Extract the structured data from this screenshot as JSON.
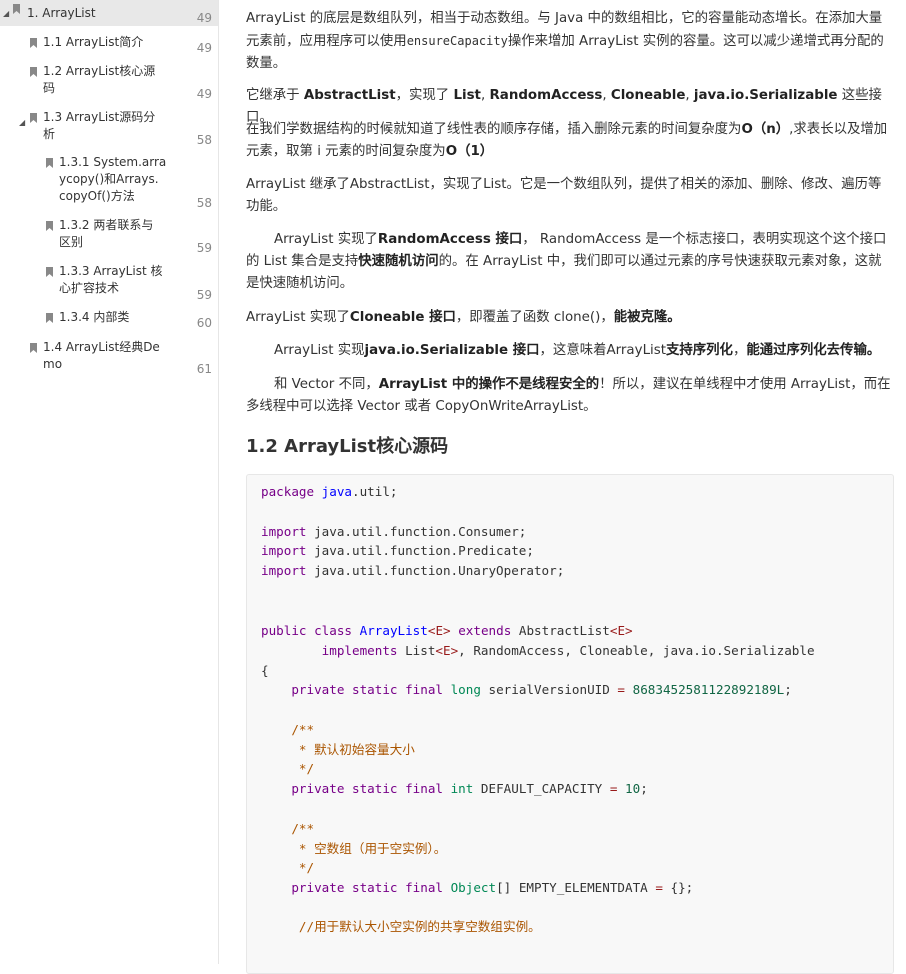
{
  "toc": [
    {
      "label": "1. ArrayList",
      "page": "49"
    },
    {
      "label": "1.1 ArrayList简介",
      "page": "49"
    },
    {
      "label_lines": [
        "1.2 ArrayList核心源",
        "码"
      ],
      "page": "49"
    },
    {
      "label_lines": [
        "1.3 ArrayList源码分",
        "析"
      ],
      "page": "58"
    },
    {
      "label_lines": [
        "1.3.1 System.arra",
        "ycopy()和Arrays.",
        "copyOf()方法"
      ],
      "page": "58"
    },
    {
      "label_lines": [
        "1.3.2 两者联系与",
        "区别"
      ],
      "page": "59"
    },
    {
      "label_lines": [
        "1.3.3 ArrayList 核",
        "心扩容技术"
      ],
      "page": "59"
    },
    {
      "label": "1.3.4 内部类",
      "page": "60"
    },
    {
      "label_lines": [
        "1.4  ArrayList经典De",
        "mo"
      ],
      "page": "61"
    }
  ],
  "content": {
    "p1": {
      "a": "ArrayList 的底层是数组队列，相当于动态数组。与 Java 中的数组相比，它的容量能动态增长。在添加大量元素前，应用程序可以使用",
      "code": "ensureCapacity",
      "b": "操作来增加 ArrayList 实例的容量。这可以减少递增式再分配的数量。"
    },
    "p2": {
      "a": "它继承于 ",
      "b1": "AbstractList",
      "c": "，实现了 ",
      "b2": "List",
      "d": ", ",
      "b3": "RandomAccess",
      "e": ", ",
      "b4": "Cloneable",
      "f": ", ",
      "b5": "java.io.Serializable",
      "g": " 这些接口。"
    },
    "p3": {
      "a": "在我们学数据结构的时候就知道了线性表的顺序存储，插入删除元素的时间复杂度为",
      "b1": "O（n）",
      "c": ",求表长以及增加元素，取第 i  元素的时间复杂度为",
      "b2": "O（1）"
    },
    "p4": " ArrayList 继承了AbstractList，实现了List。它是一个数组队列，提供了相关的添加、删除、修改、遍历等功能。",
    "p5": {
      "a": "ArrayList 实现了",
      "b1": "RandomAccess 接口",
      "c": "， RandomAccess 是一个标志接口，表明实现这个这个接口的 List 集合是支持",
      "b2": "快速随机访问",
      "d": "的。在 ArrayList 中，我们即可以通过元素的序号快速获取元素对象，这就是快速随机访问。"
    },
    "p6": {
      "a": "ArrayList 实现了",
      "b1": "Cloneable 接口",
      "c": "，即覆盖了函数 clone()，",
      "b2": "能被克隆。"
    },
    "p7": {
      "a": "ArrayList 实现",
      "b1": "java.io.Serializable 接口",
      "c": "，这意味着ArrayList",
      "b2": "支持序列化",
      "d": "，",
      "b3": "能通过序列化去传输。"
    },
    "p8": {
      "a": "和 Vector 不同，",
      "b1": "ArrayList 中的操作不是线程安全的",
      "c": "！所以，建议在单线程中才使用 ArrayList，而在多线程中可以选择 Vector 或者  CopyOnWriteArrayList。"
    },
    "heading": "1.2 ArrayList核心源码"
  },
  "code": {
    "l1": {
      "kw": "package",
      "rest": " ",
      "pkg": "java",
      "tail": ".util;"
    },
    "l3": {
      "kw": "import",
      "rest": " java.util.function.Consumer;"
    },
    "l4": {
      "kw": "import",
      "rest": " java.util.function.Predicate;"
    },
    "l5": {
      "kw": "import",
      "rest": " java.util.function.UnaryOperator;"
    },
    "l8": {
      "kw1": "public",
      "kw2": "class",
      "cls": "ArrayList",
      "gen": "<E>",
      "kw3": "extends",
      "sup": " AbstractList",
      "gen2": "<E>"
    },
    "l9": {
      "kw": "implements",
      "rest": " List",
      "gen": "<E>",
      "tail": ", RandomAccess, Cloneable, java.io.Serializable"
    },
    "l10": "{",
    "l11": {
      "kw": "private static final",
      "ty": "long",
      "name": " serialVersionUID ",
      "op": "=",
      "num": "8683452581122892189L",
      "tail": ";"
    },
    "l13": "/**",
    "l14": " * 默认初始容量大小",
    "l15": " */",
    "l16": {
      "kw": "private static final",
      "ty": "int",
      "name": " DEFAULT_CAPACITY ",
      "op": "=",
      "num": "10",
      "tail": ";"
    },
    "l18": "/**",
    "l19": " * 空数组（用于空实例）。",
    "l20": " */",
    "l21": {
      "kw": "private static final",
      "ty": "Object",
      "name": "[] EMPTY_ELEMENTDATA ",
      "op": "=",
      "tail": " {};"
    },
    "l23": " //用于默认大小空实例的共享空数组实例。"
  },
  "colors": {
    "keyword": "#770088",
    "type": "#008855",
    "definition": "#0000ff",
    "number": "#116644",
    "comment": "#aa5500",
    "operator": "#981a1a"
  }
}
